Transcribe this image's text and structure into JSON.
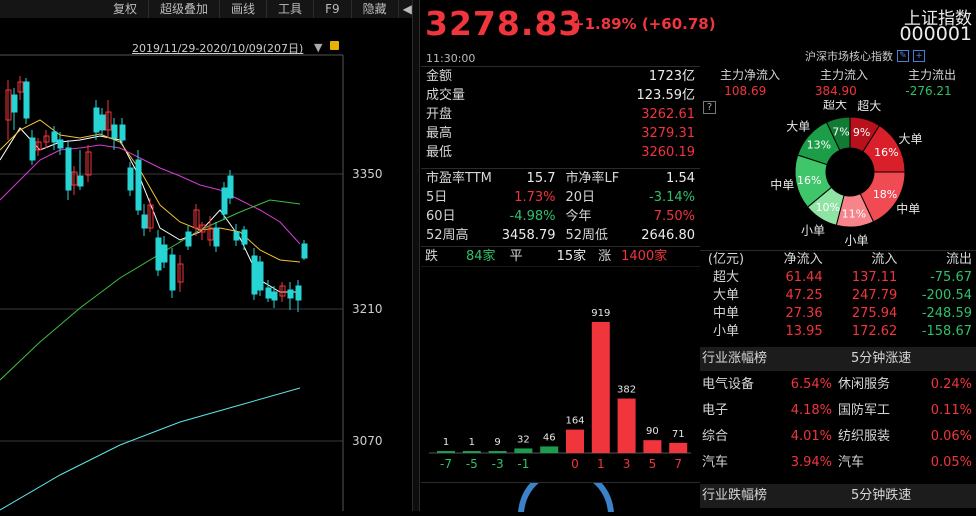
{
  "toolbar": {
    "items": [
      "复权",
      "超级叠加",
      "画线",
      "工具",
      "F9",
      "隐藏"
    ]
  },
  "kline": {
    "range_label": "2019/11/29-2020/10/09(207日)",
    "price_ticks": [
      "3350",
      "3210",
      "3070"
    ]
  },
  "quote": {
    "price": "3278.83",
    "change": "+1.89% (+60.78)",
    "time": "11:30:00",
    "name": "上证指数",
    "code": "000001",
    "sub_label": "沪深市场核心指数"
  },
  "stats": [
    {
      "label": "金额",
      "value": "1723亿",
      "tone": "wh"
    },
    {
      "label": "成交量",
      "value": "123.59亿",
      "tone": "wh"
    },
    {
      "label": "开盘",
      "value": "3262.61",
      "tone": "up"
    },
    {
      "label": "最高",
      "value": "3279.31",
      "tone": "up"
    },
    {
      "label": "最低",
      "value": "3260.19",
      "tone": "up"
    }
  ],
  "stats2": [
    [
      {
        "label": "市盈率TTM",
        "value": "15.7",
        "tone": "wh"
      },
      {
        "label": "市净率LF",
        "value": "1.54",
        "tone": "wh"
      }
    ],
    [
      {
        "label": "5日",
        "value": "1.73%",
        "tone": "up"
      },
      {
        "label": "20日",
        "value": "-3.14%",
        "tone": "dn"
      }
    ],
    [
      {
        "label": "60日",
        "value": "-4.98%",
        "tone": "dn"
      },
      {
        "label": "今年",
        "value": "7.50%",
        "tone": "up"
      }
    ],
    [
      {
        "label": "52周高",
        "value": "3458.79",
        "tone": "wh"
      },
      {
        "label": "52周低",
        "value": "2646.80",
        "tone": "wh"
      }
    ]
  ],
  "distribution": {
    "down_label": "跌",
    "down_count": "84家",
    "flat_label": "平",
    "flat_count": "15家",
    "up_label": "涨",
    "up_count": "1400家",
    "bins": [
      {
        "label": "-7",
        "value": 1,
        "tone": "dn"
      },
      {
        "label": "-5",
        "value": 1,
        "tone": "dn"
      },
      {
        "label": "-3",
        "value": 9,
        "tone": "dn"
      },
      {
        "label": "-1",
        "value": 32,
        "tone": "dn"
      },
      {
        "label": "",
        "value": 46,
        "tone": "dn"
      },
      {
        "label": "0",
        "value": 164,
        "tone": "up"
      },
      {
        "label": "1",
        "value": 919,
        "tone": "up"
      },
      {
        "label": "3",
        "value": 382,
        "tone": "up"
      },
      {
        "label": "5",
        "value": 90,
        "tone": "up"
      },
      {
        "label": "7",
        "value": 71,
        "tone": "up"
      }
    ]
  },
  "flow": {
    "headers": [
      "主力净流入",
      "主力流入",
      "主力流出"
    ],
    "values": [
      {
        "v": "108.69",
        "tone": "up"
      },
      {
        "v": "384.90",
        "tone": "up"
      },
      {
        "v": "-276.21",
        "tone": "dn"
      }
    ],
    "donut": [
      {
        "label": "超大",
        "pct": "9%",
        "value": 9,
        "color": "#b7121c"
      },
      {
        "label": "大单",
        "pct": "16%",
        "value": 16,
        "color": "#d81f2a"
      },
      {
        "label": "中单",
        "pct": "18%",
        "value": 18,
        "color": "#f04a52"
      },
      {
        "label": "小单",
        "pct": "11%",
        "value": 11,
        "color": "#f6848a"
      },
      {
        "label": "小单",
        "pct": "10%",
        "value": 10,
        "color": "#8fe4a4"
      },
      {
        "label": "中单",
        "pct": "16%",
        "value": 16,
        "color": "#3fc66a"
      },
      {
        "label": "大单",
        "pct": "13%",
        "value": 13,
        "color": "#1b9e47"
      },
      {
        "label": "超大",
        "pct": "7%",
        "value": 7,
        "color": "#117a33"
      }
    ],
    "table_headers": [
      "(亿元)",
      "净流入",
      "流入",
      "流出"
    ],
    "table_rows": [
      {
        "name": "超大",
        "net": "61.44",
        "in": "137.11",
        "out": "-75.67"
      },
      {
        "name": "大单",
        "net": "47.25",
        "in": "247.79",
        "out": "-200.54"
      },
      {
        "name": "中单",
        "net": "27.36",
        "in": "275.94",
        "out": "-248.59"
      },
      {
        "name": "小单",
        "net": "13.95",
        "in": "172.62",
        "out": "-158.67"
      }
    ]
  },
  "industry": {
    "header_left": "行业涨幅榜",
    "header_right": "5分钟涨速",
    "rows": [
      {
        "a": "电气设备",
        "av": "6.54%",
        "b": "休闲服务",
        "bv": "0.24%"
      },
      {
        "a": "电子",
        "av": "4.18%",
        "b": "国防军工",
        "bv": "0.11%"
      },
      {
        "a": "综合",
        "av": "4.01%",
        "b": "纺织服装",
        "bv": "0.06%"
      },
      {
        "a": "汽车",
        "av": "3.94%",
        "b": "汽车",
        "bv": "0.05%"
      }
    ],
    "header2_left": "行业跌幅榜",
    "header2_right": "5分钟跌速"
  },
  "colors": {
    "up": "#f0353d",
    "down": "#2ec16a",
    "candle_down": "#27d4d4",
    "ma5": "#ffffff",
    "ma10": "#f2c230",
    "ma20": "#d63cd6",
    "ma60": "#3fbf3f",
    "ma120": "#5ee6e6"
  }
}
